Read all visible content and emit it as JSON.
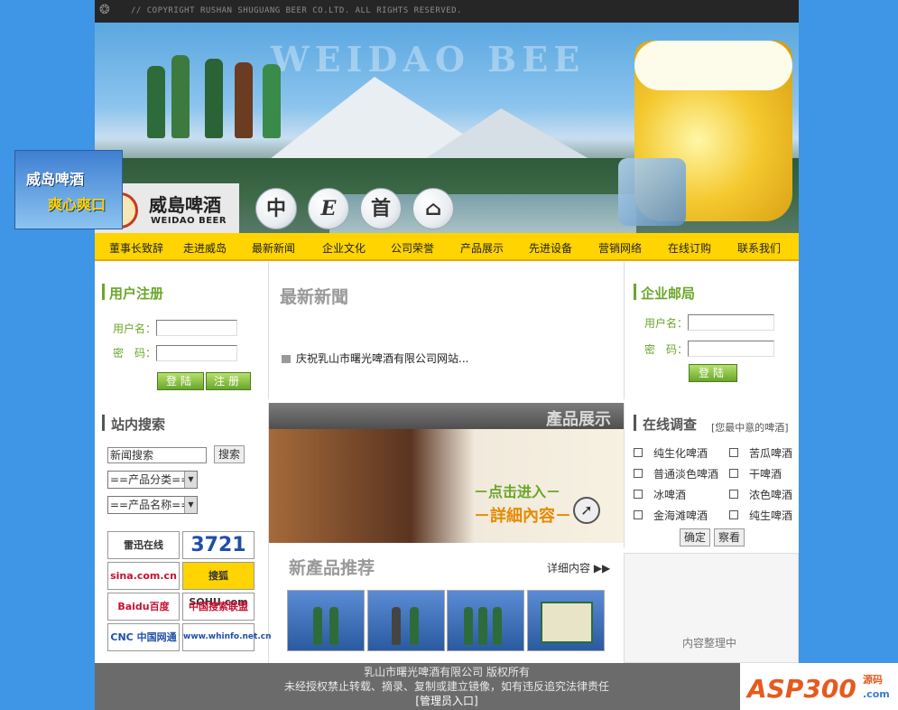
{
  "topbar": {
    "copyright": "// COPYRIGHT RUSHAN SHUGUANG BEER CO.LTD. ALL RIGHTS RESERVED."
  },
  "banner": {
    "watermark": "WEIDAO BEE",
    "brand_cn": "威島啤酒",
    "brand_en": "WEIDAO BEER",
    "circle_buttons": [
      "中",
      "E",
      "首",
      "⌂"
    ]
  },
  "nav": [
    "董事长致辞",
    "走进威岛",
    "最新新闻",
    "企业文化",
    "公司荣誉",
    "产品展示",
    "先进设备",
    "营销网络",
    "在线订购",
    "联系我们"
  ],
  "register": {
    "title": "用户注册",
    "username_label": "用户名：",
    "password_label": "密　码：",
    "login_button": "登陆",
    "register_button": "注册"
  },
  "news": {
    "title": "最新新聞",
    "items": [
      "庆祝乳山市曙光啤酒有限公司网站..."
    ]
  },
  "mail": {
    "title": "企业邮局",
    "username_label": "用户名：",
    "password_label": "密　码：",
    "login_button": "登陆"
  },
  "search": {
    "title": "站内搜索",
    "input_value": "新闻搜索",
    "button": "搜索",
    "select_category": "==产品分类==",
    "select_name": "==产品名称=="
  },
  "links": [
    {
      "label": "雷迅在线",
      "color": "#1f4fa8"
    },
    {
      "label": "3721",
      "color": "#1f4fa8"
    },
    {
      "label": "sina.com.cn",
      "color": "#c8102e"
    },
    {
      "label": "搜狐 SOHU.com",
      "color": "#000000"
    },
    {
      "label": "Baidu百度",
      "color": "#c8102e"
    },
    {
      "label": "中国搜索联盟",
      "color": "#c8102e"
    },
    {
      "label": "CNC 中国网通",
      "color": "#1f4fa8"
    },
    {
      "label": "www.whinfo.net.cn",
      "color": "#1f4fa8"
    }
  ],
  "product_show": {
    "title": "產品展示",
    "cta_line1": "－点击进入－",
    "cta_line2": "－詳細內容－"
  },
  "survey": {
    "title": "在线调查",
    "subtitle": "[您最中意的啤酒]",
    "options_left": [
      "纯生化啤酒",
      "普通淡色啤酒",
      "冰啤酒",
      "金海滩啤酒"
    ],
    "options_right": [
      "苦瓜啤酒",
      "干啤酒",
      "浓色啤酒",
      "纯生啤酒"
    ],
    "confirm": "确定",
    "view": "察看"
  },
  "new_products": {
    "title": "新產品推荐",
    "more": "详细内容 ▶▶"
  },
  "right_bottom": {
    "text": "内容整理中"
  },
  "footer": {
    "line1": "乳山市曙光啤酒有限公司 版权所有",
    "line2": "未经授权禁止转载、摘录、复制或建立镜像，如有违反追究法律责任",
    "line3": "[管理员入口]"
  },
  "side_ad": {
    "line1": "威岛啤酒",
    "line2": "爽心爽口"
  },
  "badge": {
    "main": "ASP300",
    "sub1": "源码",
    "sub2": ".com"
  }
}
